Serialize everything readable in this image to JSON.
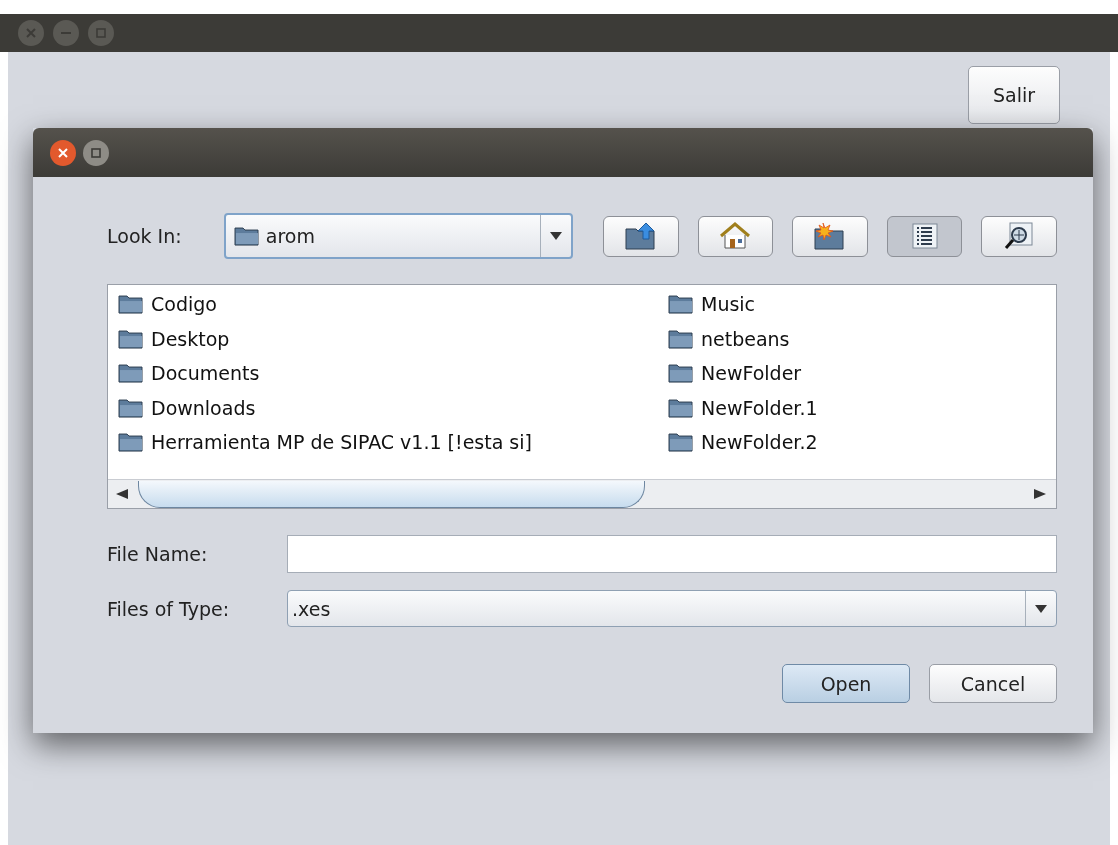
{
  "main_window": {
    "controls": [
      {
        "kind": "close"
      },
      {
        "kind": "minimize"
      },
      {
        "kind": "maximize"
      }
    ],
    "exit_button": "Salir"
  },
  "dialog": {
    "controls": [
      {
        "kind": "close"
      },
      {
        "kind": "maximize"
      }
    ],
    "look_in": {
      "label": "Look In:",
      "value": "arom"
    },
    "toolbar": [
      {
        "kind": "up",
        "selected": false
      },
      {
        "kind": "home",
        "selected": false
      },
      {
        "kind": "new-folder",
        "selected": false
      },
      {
        "kind": "list",
        "selected": true
      },
      {
        "kind": "details",
        "selected": false
      }
    ],
    "files": [
      {
        "name": "Codigo",
        "selected": false
      },
      {
        "name": "Desktop",
        "selected": false
      },
      {
        "name": "Documents",
        "selected": false
      },
      {
        "name": "Downloads",
        "selected": false
      },
      {
        "name": "Herramienta MP de SIPAC v1.1 [!esta si]",
        "selected": false
      },
      {
        "name": "Music",
        "selected": false
      },
      {
        "name": "netbeans",
        "selected": false
      },
      {
        "name": "NewFolder",
        "selected": false
      },
      {
        "name": "NewFolder.1",
        "selected": false
      },
      {
        "name": "NewFolder.2",
        "selected": false
      }
    ],
    "file_name": {
      "label": "File Name:"
    },
    "file_type": {
      "label": "Files of Type:",
      "value": ".xes"
    },
    "buttons": [
      {
        "label": "Open",
        "default": true
      },
      {
        "label": "Cancel",
        "default": false
      }
    ]
  }
}
